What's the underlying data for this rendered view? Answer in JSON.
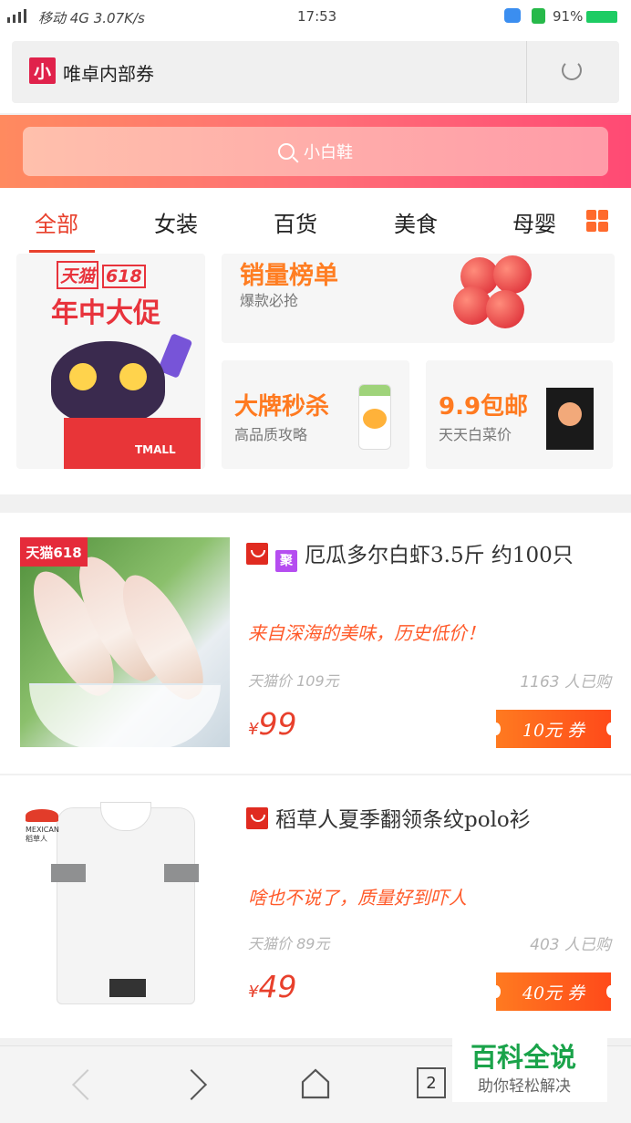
{
  "status_bar": {
    "carrier": "移动 4G",
    "speed": "3.07K/s",
    "time": "17:53",
    "battery": "91%"
  },
  "header": {
    "logo_char": "小",
    "title": "唯卓内部券"
  },
  "search": {
    "placeholder": "小白鞋"
  },
  "tabs": [
    "全部",
    "女装",
    "百货",
    "美食",
    "母婴"
  ],
  "promo": {
    "tmall_brand": "天猫",
    "tmall_618": "618",
    "tmall_slogan": "年中大促",
    "tmall_box_text": "TMALL",
    "sales_title": "销量榜单",
    "sales_sub": "爆款必抢",
    "brand_title": "大牌秒杀",
    "brand_sub": "高品质攻略",
    "nine_title": "9.9包邮",
    "nine_sub": "天天白菜价"
  },
  "products": [
    {
      "tag": "天猫618",
      "badge2": "聚",
      "title": "厄瓜多尔白虾3.5斤 约100只",
      "desc": "来自深海的美味，历史低价！",
      "original_price": "天猫价 109元",
      "sold": "1163 人已购",
      "currency": "¥",
      "price": "99",
      "coupon": "10元 券"
    },
    {
      "brand_logo": "MEXICAN 稻草人",
      "title": "稻草人夏季翻领条纹polo衫",
      "desc": "啥也不说了，质量好到吓人",
      "original_price": "天猫价 89元",
      "sold": "403 人已购",
      "currency": "¥",
      "price": "49",
      "coupon": "40元 券"
    }
  ],
  "nav": {
    "tab_count": "2"
  },
  "watermark": {
    "title": "百科全说",
    "subtitle": "助你轻松解决"
  }
}
